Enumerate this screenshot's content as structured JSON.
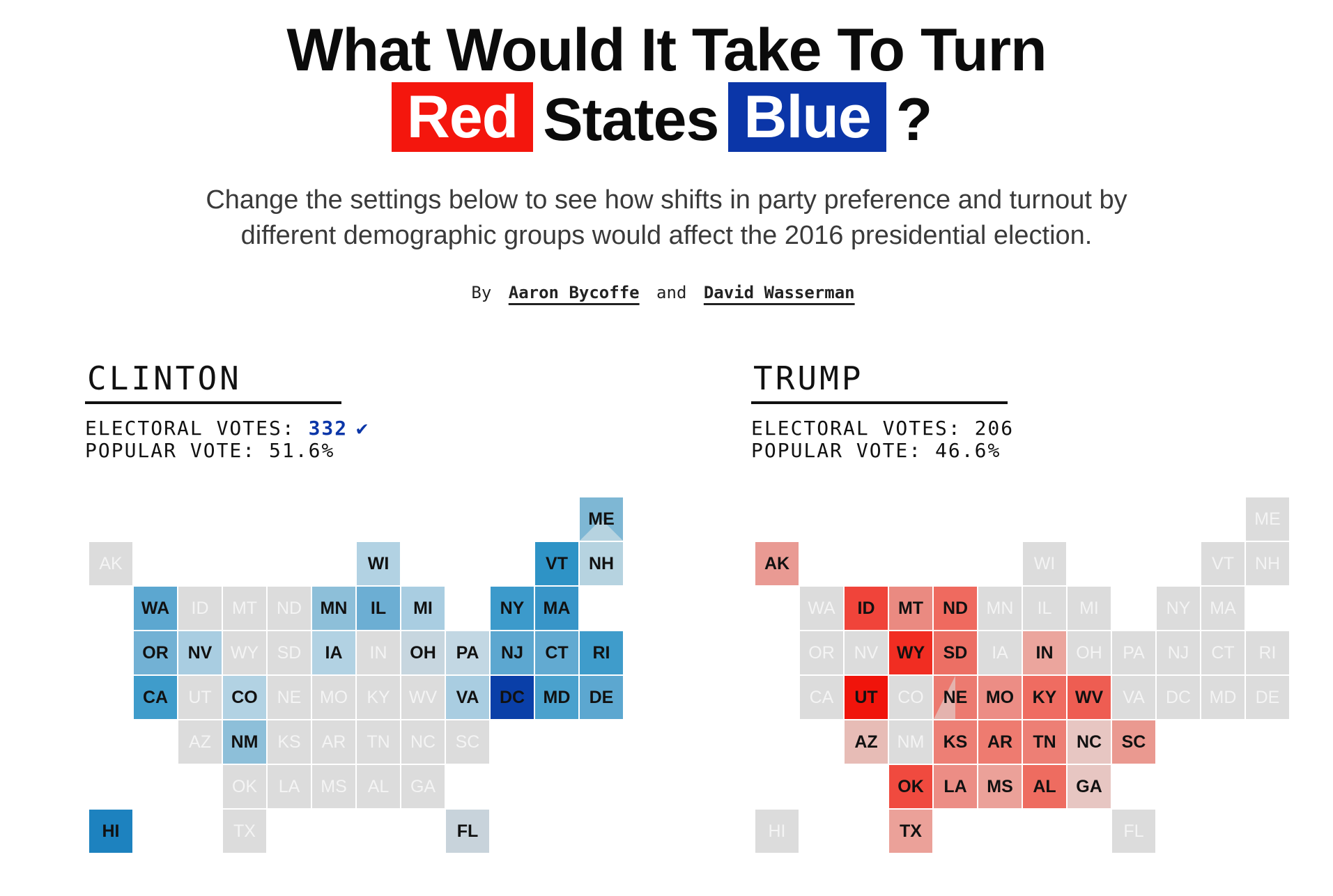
{
  "header": {
    "title_line1": "What Would It Take To Turn",
    "title_red": "Red",
    "title_mid": "States",
    "title_blue": "Blue",
    "title_end": "?",
    "dek_line1": "Change the settings below to see how shifts in party preference and turnout by",
    "dek_line2": "different demographic groups would affect the 2016 presidential election.",
    "byline_by": "By",
    "byline_and": "and",
    "author1": "Aaron Bycoffe",
    "author2": "David Wasserman"
  },
  "colors": {
    "title_red_bg": "#f4160d",
    "title_blue_bg": "#0b36a8",
    "empty_tile": "#dcdcdc",
    "empty_text": "#f4f4f4",
    "dark_text": "#111111"
  },
  "clinton": {
    "name": "CLINTON",
    "ev_label": "ELECTORAL VOTES:",
    "ev_value": "332",
    "winner_mark": "✔",
    "pv_label": "POPULAR VOTE:",
    "pv_value": "51.6%"
  },
  "trump": {
    "name": "TRUMP",
    "ev_label": "ELECTORAL VOTES:",
    "ev_value": "206",
    "pv_label": "POPULAR VOTE:",
    "pv_value": "46.6%"
  },
  "states": [
    {
      "abbr": "AK",
      "col": 0,
      "row": 1,
      "clinton": "#dcdcdc",
      "trump": "#e99a93"
    },
    {
      "abbr": "ME",
      "col": 11,
      "row": 0,
      "clinton": "#7eb7d4",
      "trump": "#dcdcdc",
      "clinton_split": "#b6d3e0"
    },
    {
      "abbr": "WI",
      "col": 6,
      "row": 1,
      "clinton": "#b2d2e3",
      "trump": "#dcdcdc"
    },
    {
      "abbr": "VT",
      "col": 10,
      "row": 1,
      "clinton": "#2e93c6",
      "trump": "#dcdcdc"
    },
    {
      "abbr": "NH",
      "col": 11,
      "row": 1,
      "clinton": "#b6d3e0",
      "trump": "#dcdcdc"
    },
    {
      "abbr": "WA",
      "col": 1,
      "row": 2,
      "clinton": "#5ca7d0",
      "trump": "#dcdcdc"
    },
    {
      "abbr": "ID",
      "col": 2,
      "row": 2,
      "clinton": "#dcdcdc",
      "trump": "#f0443a"
    },
    {
      "abbr": "MT",
      "col": 3,
      "row": 2,
      "clinton": "#dcdcdc",
      "trump": "#ea8a81"
    },
    {
      "abbr": "ND",
      "col": 4,
      "row": 2,
      "clinton": "#dcdcdc",
      "trump": "#ef6a5f"
    },
    {
      "abbr": "MN",
      "col": 5,
      "row": 2,
      "clinton": "#8dbfd9",
      "trump": "#dcdcdc"
    },
    {
      "abbr": "IL",
      "col": 6,
      "row": 2,
      "clinton": "#6caed3",
      "trump": "#dcdcdc"
    },
    {
      "abbr": "MI",
      "col": 7,
      "row": 2,
      "clinton": "#a9cde1",
      "trump": "#dcdcdc"
    },
    {
      "abbr": "NY",
      "col": 9,
      "row": 2,
      "clinton": "#3c9acb",
      "trump": "#dcdcdc"
    },
    {
      "abbr": "MA",
      "col": 10,
      "row": 2,
      "clinton": "#3895c8",
      "trump": "#dcdcdc"
    },
    {
      "abbr": "OR",
      "col": 1,
      "row": 3,
      "clinton": "#72b1d4",
      "trump": "#dcdcdc"
    },
    {
      "abbr": "NV",
      "col": 2,
      "row": 3,
      "clinton": "#a9cde1",
      "trump": "#dcdcdc"
    },
    {
      "abbr": "WY",
      "col": 3,
      "row": 3,
      "clinton": "#dcdcdc",
      "trump": "#f12d22"
    },
    {
      "abbr": "SD",
      "col": 4,
      "row": 3,
      "clinton": "#dcdcdc",
      "trump": "#ec6f64"
    },
    {
      "abbr": "IA",
      "col": 5,
      "row": 3,
      "clinton": "#b2d2e3",
      "trump": "#dcdcdc"
    },
    {
      "abbr": "IN",
      "col": 6,
      "row": 3,
      "clinton": "#dcdcdc",
      "trump": "#eba59d"
    },
    {
      "abbr": "OH",
      "col": 7,
      "row": 3,
      "clinton": "#c7d6df",
      "trump": "#dcdcdc"
    },
    {
      "abbr": "PA",
      "col": 8,
      "row": 3,
      "clinton": "#c2d7e3",
      "trump": "#dcdcdc"
    },
    {
      "abbr": "NJ",
      "col": 9,
      "row": 3,
      "clinton": "#5ca7d0",
      "trump": "#dcdcdc"
    },
    {
      "abbr": "CT",
      "col": 10,
      "row": 3,
      "clinton": "#62aad1",
      "trump": "#dcdcdc"
    },
    {
      "abbr": "RI",
      "col": 11,
      "row": 3,
      "clinton": "#3f9ccb",
      "trump": "#dcdcdc"
    },
    {
      "abbr": "CA",
      "col": 1,
      "row": 4,
      "clinton": "#3f9ccb",
      "trump": "#dcdcdc"
    },
    {
      "abbr": "UT",
      "col": 2,
      "row": 4,
      "clinton": "#dcdcdc",
      "trump": "#f0140b"
    },
    {
      "abbr": "CO",
      "col": 3,
      "row": 4,
      "clinton": "#b2d2e3",
      "trump": "#dcdcdc"
    },
    {
      "abbr": "NE",
      "col": 4,
      "row": 4,
      "clinton": "#dcdcdc",
      "trump": "#ec7a70",
      "trump_split": "#e4b3ae"
    },
    {
      "abbr": "MO",
      "col": 5,
      "row": 4,
      "clinton": "#dcdcdc",
      "trump": "#ec8d85"
    },
    {
      "abbr": "KY",
      "col": 6,
      "row": 4,
      "clinton": "#dcdcdc",
      "trump": "#ef6c61"
    },
    {
      "abbr": "WV",
      "col": 7,
      "row": 4,
      "clinton": "#dcdcdc",
      "trump": "#ee5d52"
    },
    {
      "abbr": "VA",
      "col": 8,
      "row": 4,
      "clinton": "#a9cde1",
      "trump": "#dcdcdc"
    },
    {
      "abbr": "DC",
      "col": 9,
      "row": 4,
      "clinton": "#0a3fa8",
      "trump": "#dcdcdc"
    },
    {
      "abbr": "MD",
      "col": 10,
      "row": 4,
      "clinton": "#4aa1cd",
      "trump": "#dcdcdc"
    },
    {
      "abbr": "DE",
      "col": 11,
      "row": 4,
      "clinton": "#5ca7d0",
      "trump": "#dcdcdc"
    },
    {
      "abbr": "AZ",
      "col": 2,
      "row": 5,
      "clinton": "#dcdcdc",
      "trump": "#e7bcb6"
    },
    {
      "abbr": "NM",
      "col": 3,
      "row": 5,
      "clinton": "#8dbfd9",
      "trump": "#dcdcdc"
    },
    {
      "abbr": "KS",
      "col": 4,
      "row": 5,
      "clinton": "#dcdcdc",
      "trump": "#ed7f75"
    },
    {
      "abbr": "AR",
      "col": 5,
      "row": 5,
      "clinton": "#dcdcdc",
      "trump": "#ee7b70"
    },
    {
      "abbr": "TN",
      "col": 6,
      "row": 5,
      "clinton": "#dcdcdc",
      "trump": "#ed7f75"
    },
    {
      "abbr": "NC",
      "col": 7,
      "row": 5,
      "clinton": "#dcdcdc",
      "trump": "#e7c6c2"
    },
    {
      "abbr": "SC",
      "col": 8,
      "row": 5,
      "clinton": "#dcdcdc",
      "trump": "#ea9990"
    },
    {
      "abbr": "OK",
      "col": 3,
      "row": 6,
      "clinton": "#dcdcdc",
      "trump": "#f04a3f"
    },
    {
      "abbr": "LA",
      "col": 4,
      "row": 6,
      "clinton": "#dcdcdc",
      "trump": "#ec8d85"
    },
    {
      "abbr": "MS",
      "col": 5,
      "row": 6,
      "clinton": "#dcdcdc",
      "trump": "#eba199"
    },
    {
      "abbr": "AL",
      "col": 6,
      "row": 6,
      "clinton": "#dcdcdc",
      "trump": "#ee6c60"
    },
    {
      "abbr": "GA",
      "col": 7,
      "row": 6,
      "clinton": "#dcdcdc",
      "trump": "#e7c6c2"
    },
    {
      "abbr": "HI",
      "col": 0,
      "row": 7,
      "clinton": "#1d82bf",
      "trump": "#dcdcdc"
    },
    {
      "abbr": "TX",
      "col": 3,
      "row": 7,
      "clinton": "#dcdcdc",
      "trump": "#eba199"
    },
    {
      "abbr": "FL",
      "col": 8,
      "row": 7,
      "clinton": "#c8d3db",
      "trump": "#dcdcdc"
    }
  ]
}
